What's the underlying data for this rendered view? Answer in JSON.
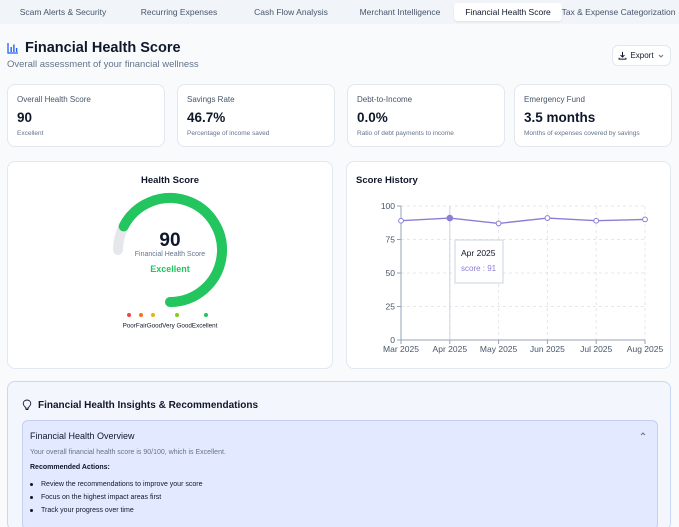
{
  "tabs": [
    {
      "label": "Scam Alerts & Security"
    },
    {
      "label": "Recurring Expenses"
    },
    {
      "label": "Cash Flow Analysis"
    },
    {
      "label": "Merchant Intelligence"
    },
    {
      "label": "Financial Health Score",
      "active": true
    },
    {
      "label": "Tax & Expense Categorization"
    }
  ],
  "header": {
    "title": "Financial Health Score",
    "subtitle": "Overall assessment of your financial wellness",
    "export_label": "Export"
  },
  "stats": [
    {
      "label": "Overall Health Score",
      "value": "90",
      "sub": "Excellent"
    },
    {
      "label": "Savings Rate",
      "value": "46.7%",
      "sub": "Percentage of income saved"
    },
    {
      "label": "Debt-to-Income",
      "value": "0.0%",
      "sub": "Ratio of debt payments to income"
    },
    {
      "label": "Emergency Fund",
      "value": "3.5 months",
      "sub": "Months of expenses covered by savings"
    }
  ],
  "gauge": {
    "title": "Health Score",
    "score": 90,
    "max": 100,
    "score_text": "90",
    "caption": "Financial Health Score",
    "rating": "Excellent",
    "legend_text": "PoorFairGoodVery GoodExcellent",
    "legend_colors": [
      "#ef4444",
      "#f97316",
      "#eab308",
      "#84cc16",
      "#22c55e"
    ],
    "fill_color": "#22c55e",
    "track_color": "#e5e7eb"
  },
  "history": {
    "title": "Score History",
    "tooltip_label": "Apr 2025",
    "tooltip_value": "score : 91"
  },
  "chart_data": {
    "type": "line",
    "title": "Score History",
    "x": [
      "Mar 2025",
      "Apr 2025",
      "May 2025",
      "Jun 2025",
      "Jul 2025",
      "Aug 2025"
    ],
    "series": [
      {
        "name": "score",
        "values": [
          89,
          91,
          87,
          91,
          89,
          90
        ]
      }
    ],
    "ylim": [
      0,
      100
    ],
    "yticks": [
      0,
      25,
      50,
      75,
      100
    ],
    "grid": true,
    "color": "#8b7fd4"
  },
  "insights": {
    "title": "Financial Health Insights & Recommendations",
    "overview_title": "Financial Health Overview",
    "overview_text": "Your overall financial health score is 90/100, which is Excellent.",
    "recommended_title": "Recommended Actions:",
    "actions": [
      "Review the recommendations to improve your score",
      "Focus on the highest impact areas first",
      "Track your progress over time"
    ]
  }
}
